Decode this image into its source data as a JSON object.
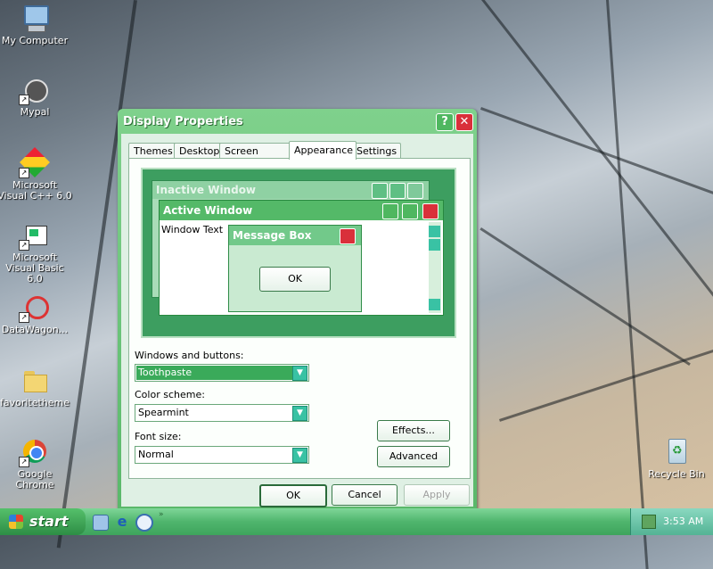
{
  "desktop": {
    "icons": [
      {
        "label": "My Computer"
      },
      {
        "label": "Mypal"
      },
      {
        "label": "Microsoft Visual C++ 6.0"
      },
      {
        "label": "Microsoft Visual Basic 6.0"
      },
      {
        "label": "DataWagon..."
      },
      {
        "label": "favoritetheme"
      },
      {
        "label": "Google Chrome"
      },
      {
        "label": "Recycle Bin"
      }
    ]
  },
  "dialog": {
    "title": "Display Properties",
    "tabs": [
      "Themes",
      "Desktop",
      "Screen Saver",
      "Appearance",
      "Settings"
    ],
    "selected_tab": "Appearance",
    "preview": {
      "inactive_title": "Inactive Window",
      "active_title": "Active Window",
      "window_text": "Window Text",
      "message_box_title": "Message Box",
      "ok_label": "OK"
    },
    "windows_and_buttons": {
      "label": "Windows and buttons:",
      "value": "Toothpaste"
    },
    "color_scheme": {
      "label": "Color scheme:",
      "value": "Spearmint"
    },
    "font_size": {
      "label": "Font size:",
      "value": "Normal"
    },
    "effects_label": "Effects...",
    "advanced_label": "Advanced",
    "ok_label": "OK",
    "cancel_label": "Cancel",
    "apply_label": "Apply"
  },
  "taskbar": {
    "start_label": "start",
    "clock": "3:53 AM"
  },
  "colors": {
    "accent": "#5ab86a",
    "close": "#d9303a",
    "combo_arrow": "#39c2a4"
  }
}
